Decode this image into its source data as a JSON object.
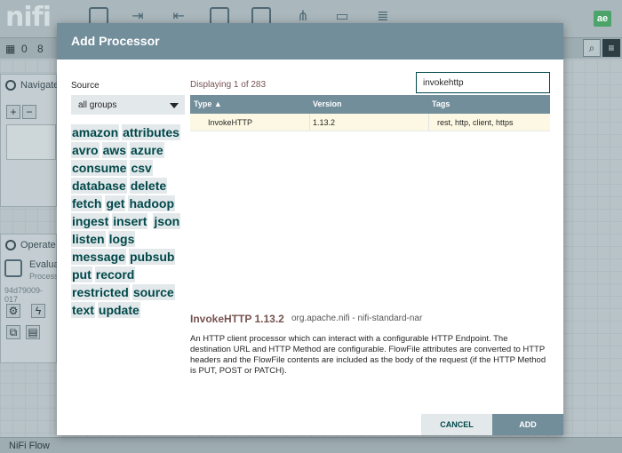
{
  "app": {
    "logo_text": "nifi",
    "user_badge": "ae",
    "toolbar_icons": [
      "processor-icon",
      "input-port-icon",
      "output-port-icon",
      "process-group-icon",
      "remote-process-group-icon",
      "funnel-icon",
      "template-icon",
      "label-icon"
    ],
    "status_counts": [
      "0",
      "8"
    ],
    "footer": "NiFi Flow"
  },
  "background_panels": {
    "navigate_label": "Navigate",
    "operate_label": "Operate",
    "selected_name": "Evalua",
    "selected_sub": "Process",
    "selected_id": "94d79009-017"
  },
  "dialog": {
    "title": "Add Processor",
    "source_label": "Source",
    "source_value": "all groups",
    "tags": [
      "amazon",
      "attributes",
      "avro",
      "aws",
      "azure",
      "consume",
      "csv",
      "database",
      "delete",
      "fetch",
      "get",
      "hadoop",
      "ingest",
      "insert",
      "json",
      "listen",
      "logs",
      "message",
      "pubsub",
      "put",
      "record",
      "restricted",
      "source",
      "text",
      "update"
    ],
    "displaying": "Displaying 1 of 283",
    "filter_value": "invokehttp",
    "columns": {
      "type": "Type ▲",
      "version": "Version",
      "tags": "Tags"
    },
    "rows": [
      {
        "type": "InvokeHTTP",
        "version": "1.13.2",
        "tags": "rest, http, client, https"
      }
    ],
    "selected": {
      "title": "InvokeHTTP 1.13.2",
      "bundle": "org.apache.nifi - nifi-standard-nar",
      "description": "An HTTP client processor which can interact with a configurable HTTP Endpoint. The destination URL and HTTP Method are configurable. FlowFile attributes are converted to HTTP headers and the FlowFile contents are included as the body of the request (if the HTTP Method is PUT, POST or PATCH)."
    },
    "cancel_label": "CANCEL",
    "add_label": "ADD"
  },
  "colors": {
    "header": "#728e9b",
    "tag_text": "#004849",
    "tag_bg": "#e3e8eb",
    "accent_title": "#775351",
    "selected_row": "#fcf8e3"
  }
}
